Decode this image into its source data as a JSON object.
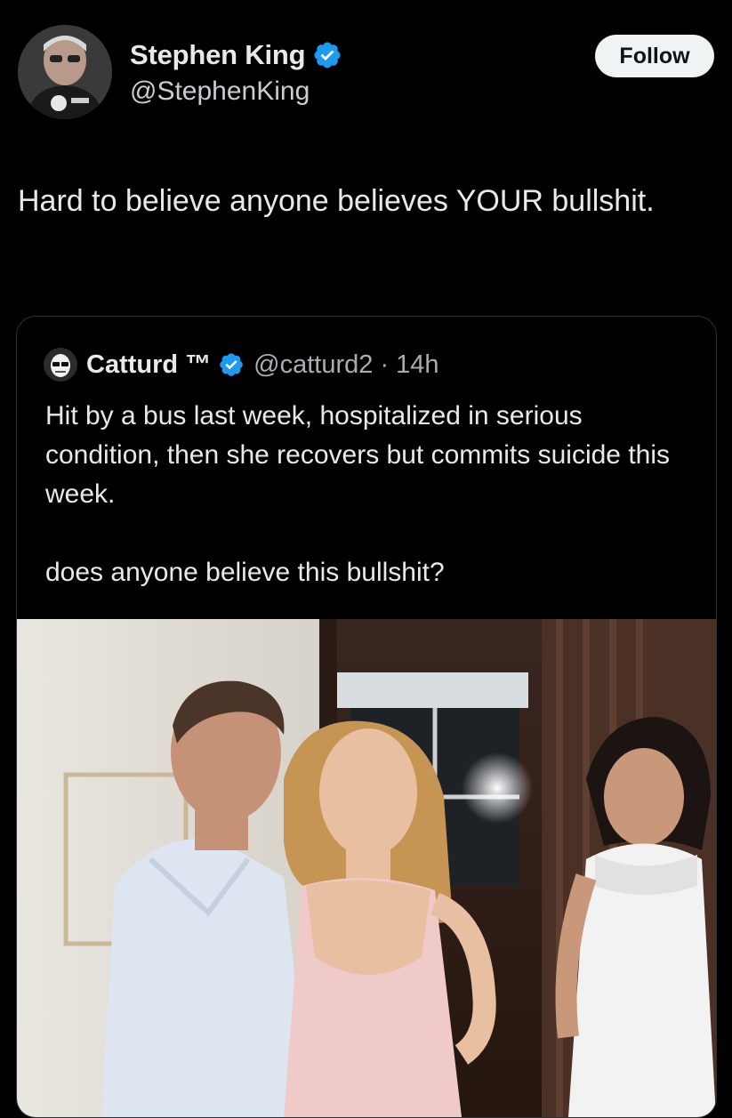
{
  "tweet": {
    "author": {
      "display_name": "Stephen King",
      "handle": "@StephenKing",
      "verified": true
    },
    "follow_label": "Follow",
    "text": "Hard to believe anyone believes YOUR bullshit."
  },
  "quoted_tweet": {
    "author": {
      "display_name": "Catturd ™",
      "handle": "@catturd2",
      "verified": true
    },
    "meta": "@catturd2 · 14h",
    "paragraphs": [
      "Hit by a bus last week, hospitalized in serious condition, then she recovers but commits suicide this week.",
      "does anyone believe this bullshit?"
    ]
  },
  "colors": {
    "background": "#000000",
    "verified_blue": "#1d9bf0",
    "follow_bg": "#eff3f4",
    "border": "#2f3336"
  },
  "icons": {
    "verified": "verified-badge-icon"
  }
}
